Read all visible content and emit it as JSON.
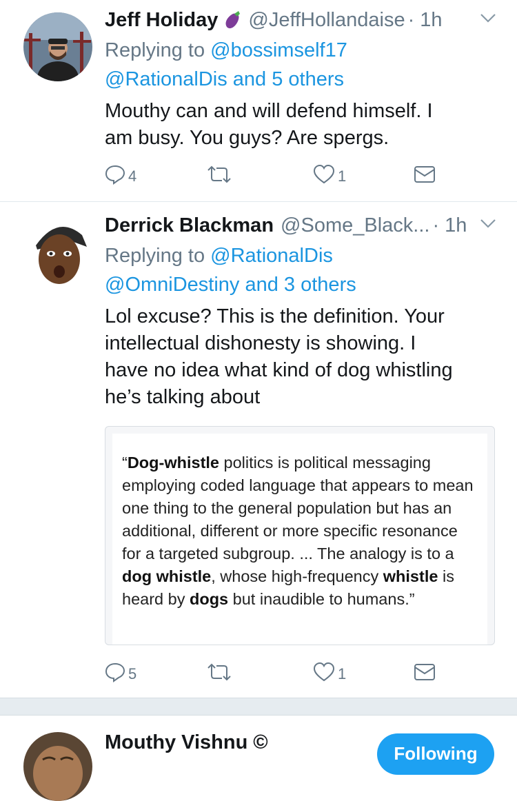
{
  "tweets": [
    {
      "name": "Jeff Holiday",
      "emoji": "🍆",
      "handle": "@JeffHollandaise",
      "time": "· 1h",
      "replying_prefix": "Replying to ",
      "replying_line1": "@bossimself17",
      "replying_line2_mention": "@RationalDis",
      "replying_line2_rest": " and 5 others",
      "text": [
        "Mouthy can and will defend himself. I",
        "am busy. You guys? Are spergs."
      ],
      "replies": "4",
      "retweets": "",
      "likes": "1"
    },
    {
      "name": "Derrick Blackman",
      "handle": "@Some_Black...",
      "time": "· 1h",
      "replying_prefix": "Replying to ",
      "replying_line1": "@RationalDis",
      "replying_line2_mention": "@OmniDestiny",
      "replying_line2_rest": " and 3 others",
      "text": [
        "Lol excuse? This is the definition. Your",
        "intellectual dishonesty is showing. I",
        "have no idea what kind of dog whistling",
        "he’s talking about"
      ],
      "replies": "5",
      "retweets": "",
      "likes": "1",
      "quote": {
        "open_quote": "“",
        "b1": "Dog-whistle",
        "t1": " politics is political messaging employing coded language that appears to mean one thing to the general population but has an additional, different or more specific resonance for a targeted subgroup. ... The analogy is to a ",
        "b2": "dog whistle",
        "t2": ", whose high-frequency ",
        "b3": "whistle",
        "t3": " is heard by ",
        "b4": "dogs",
        "t4": " but inaudible to humans.”"
      }
    },
    {
      "name": "Mouthy Vishnu",
      "badge": "©",
      "follow_label": "Following"
    }
  ],
  "colors": {
    "accent": "#1b95e0",
    "muted": "#657786",
    "follow_button": "#1da1f2"
  },
  "icons": [
    "reply-icon",
    "retweet-icon",
    "like-icon",
    "dm-icon",
    "chevron-down-icon",
    "eggplant-emoji-icon"
  ]
}
